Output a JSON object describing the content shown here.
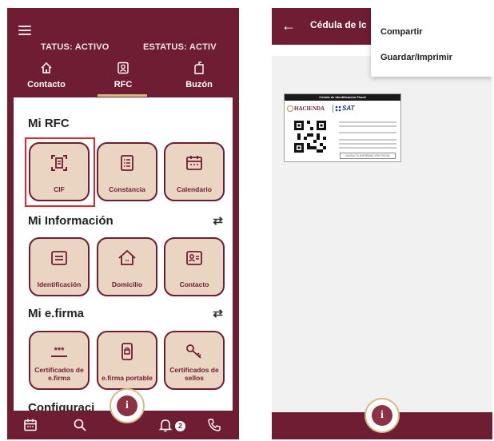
{
  "left_screen": {
    "status_labels": [
      "TATUS: ACTIVO",
      "ESTATUS: ACTIV"
    ],
    "top_nav": [
      {
        "label": "Contacto",
        "icon": "home-icon"
      },
      {
        "label": "RFC",
        "icon": "id-card-icon",
        "selected": true
      },
      {
        "label": "Buzón",
        "icon": "mailbox-icon"
      }
    ],
    "sections": [
      {
        "title": "Mi RFC",
        "tiles": [
          {
            "label": "CIF",
            "icon": "scan-document-icon",
            "highlighted": true
          },
          {
            "label": "Constancia",
            "icon": "list-document-icon"
          },
          {
            "label": "Calendario",
            "icon": "calendar-icon"
          }
        ]
      },
      {
        "title": "Mi Información",
        "tiles": [
          {
            "label": "Identificación",
            "icon": "identification-icon"
          },
          {
            "label": "Domicilio",
            "icon": "house-icon"
          },
          {
            "label": "Contacto",
            "icon": "contact-card-icon"
          }
        ]
      },
      {
        "title": "Mi e.firma",
        "tiles": [
          {
            "label": "Certificados de e.firma",
            "icon": "password-icon"
          },
          {
            "label": "e.firma portable",
            "icon": "lock-phone-icon"
          },
          {
            "label": "Certificados de sellos",
            "icon": "key-icon"
          }
        ]
      }
    ],
    "cut_off_section": "Configuraci",
    "bottom_nav": {
      "icons": [
        "calendar-icon",
        "search-icon",
        "bell-icon",
        "phone-icon"
      ],
      "notification_count": "2"
    },
    "info_button": "i"
  },
  "right_screen": {
    "title": "Cédula de Ic",
    "menu": [
      "Compartir",
      "Guardar/Imprimir"
    ],
    "document": {
      "header": "Cédula de Identificación Fiscal",
      "hacienda": "HACIENDA",
      "sat": "SAT",
      "button": "VALIDA TU INFORMACIÓN FISCAL"
    },
    "info_button": "i"
  },
  "colors": {
    "primary": "#6f1d32",
    "tile_background": "#ead4c2",
    "accent_gold": "#d8b985",
    "highlight_red": "#e0262b"
  }
}
